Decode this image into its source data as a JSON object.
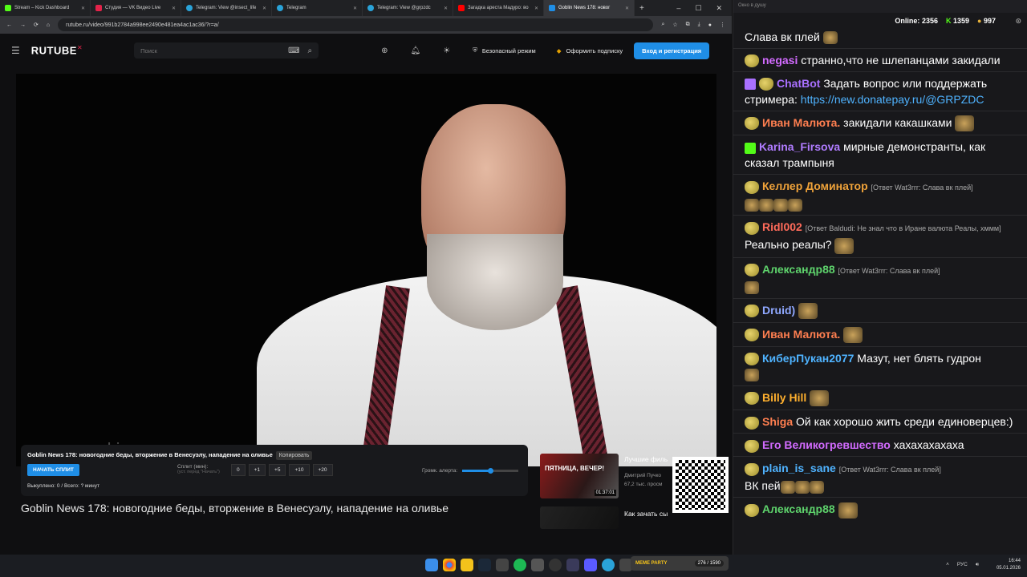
{
  "browser": {
    "tabs": [
      {
        "label": "Stream – Kick Dashboard",
        "color": "#53fc18"
      },
      {
        "label": "Студия — VK Видео Live",
        "color": "#e4234a"
      },
      {
        "label": "Telegram: View @insect_life",
        "color": "#2aa3d9"
      },
      {
        "label": "Telegram",
        "color": "#2aa3d9"
      },
      {
        "label": "Telegram: View @grpzdc",
        "color": "#2aa3d9"
      },
      {
        "label": "Загадка ареста Мадуро: во",
        "color": "#ff0000"
      },
      {
        "label": "Goblin News 178: новог",
        "color": "#1f8ee6"
      }
    ],
    "url": "rutube.ru/video/991b2784a998ee2490e481ea4ac1ac36/?r=a/",
    "controls": {
      "minimize": "–",
      "maximize": "☐",
      "close": "✕"
    }
  },
  "rutube": {
    "logo": "RUTUBE",
    "search_placeholder": "Поиск",
    "safe_mode": "Безопасный режим",
    "subscribe": "Оформить подписку",
    "login": "Вход и регистрация",
    "watermark": "opermayki.ru",
    "video_title": "Goblin News 178: новогодние беды, вторжение в Венесуэлу, нападение на оливье"
  },
  "split_widget": {
    "title": "Goblin News 178: новогодние беды, вторжение в Венесуэлу, нападение на оливье",
    "copy": "Копировать",
    "start": "НАЧАТЬ СПЛИТ",
    "split_label": "Сплит (мин):",
    "split_hint": "(уст. перед \"Начать\")",
    "buttons": [
      "0",
      "+1",
      "+5",
      "+10",
      "+20"
    ],
    "volume_label": "Громк. алерта:",
    "volume_level_pct": 50,
    "bought": "Выкуплено: 0 / Всего: ? минут"
  },
  "recommendations": [
    {
      "title": "Лучшие филь",
      "meta": "Дмитрий Пучко",
      "meta2": "67,2 тыс. просм",
      "duration": "01:37:01",
      "thumb_text": "ПЯТНИЦА, ВЕЧЕР!"
    },
    {
      "title": "Как зачать сы"
    }
  ],
  "taskbar": {
    "meme_party": "MEME PARTY",
    "meme_count": "276 / 1590",
    "lang": "РУС",
    "time": "16:44",
    "date": "05.01.2026"
  },
  "chat": {
    "window_title": "Окно в душу",
    "online_label": "Online:",
    "online": "2356",
    "kick_count": "1359",
    "coin_count": "997",
    "messages": [
      {
        "user": "",
        "color": "#ffffff",
        "text": "Слава вк плей"
      },
      {
        "user": "negasi",
        "color": "#d26bff",
        "text": "странно,что не шлепанцами закидали"
      },
      {
        "user": "ChatBot",
        "color": "#a970ff",
        "text": "Задать вопрос или поддержать стримера:",
        "link": "https://new.donatepay.ru/@GRPZDC"
      },
      {
        "user": "Иван Малюта.",
        "color": "#ff7f50",
        "text": "закидали какашками"
      },
      {
        "user": "Karina_Firsova",
        "color": "#b07cff",
        "text": "мирные демонстранты, как сказал трампыня"
      },
      {
        "user": "Келлер Доминатор",
        "color": "#f0a33a",
        "reply": "[Ответ Wat3rrr: Слава вк плей]",
        "text": ""
      },
      {
        "user": "Ridl002",
        "color": "#ff6b5a",
        "reply": "[Ответ Baldudi: Не знал что в Иране валюта Реалы, хммм]",
        "text": "Реально реалы?"
      },
      {
        "user": "Александр88",
        "color": "#5ed36c",
        "reply": "[Ответ Wat3rrr: Слава вк плей]",
        "text": ""
      },
      {
        "user": "Druid)",
        "color": "#8fa8ff",
        "text": ""
      },
      {
        "user": "Иван Малюта.",
        "color": "#ff7f50",
        "text": ""
      },
      {
        "user": "КиберПукан2077",
        "color": "#4fb3ff",
        "text": "Мазут, нет блять гудрон"
      },
      {
        "user": "Billy Hill",
        "color": "#ffb02e",
        "text": ""
      },
      {
        "user": "Shiga",
        "color": "#ff7f50",
        "text": "Ой как хорошо жить среди единоверцев:)"
      },
      {
        "user": "Его Великогревшество",
        "color": "#d26bff",
        "text": "хахахахахаха"
      },
      {
        "user": "plain_is_sane",
        "color": "#4fb3ff",
        "reply": "[Ответ Wat3rrr: Слава вк плей]",
        "text": "ВК пей"
      },
      {
        "user": "Александр88",
        "color": "#5ed36c",
        "text": ""
      }
    ]
  }
}
